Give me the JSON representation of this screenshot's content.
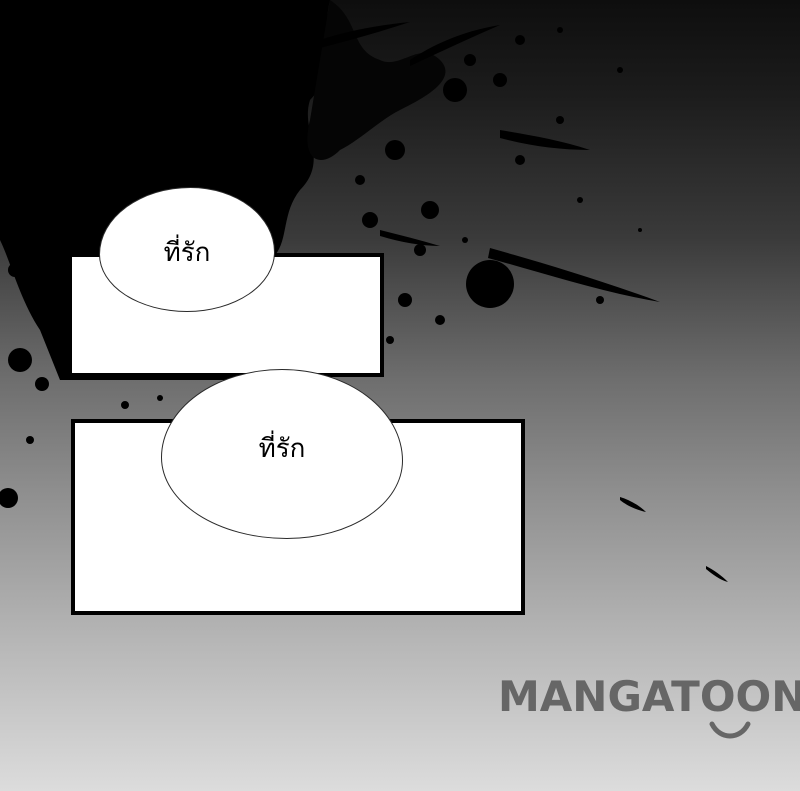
{
  "panels": [
    {
      "bubble_text": "ที่รัก"
    },
    {
      "bubble_text": "ที่รัก"
    }
  ],
  "watermark": {
    "text": "MANGATOON"
  },
  "colors": {
    "ink": "#000000",
    "panel_fill": "#ffffff",
    "watermark": "#666666"
  }
}
